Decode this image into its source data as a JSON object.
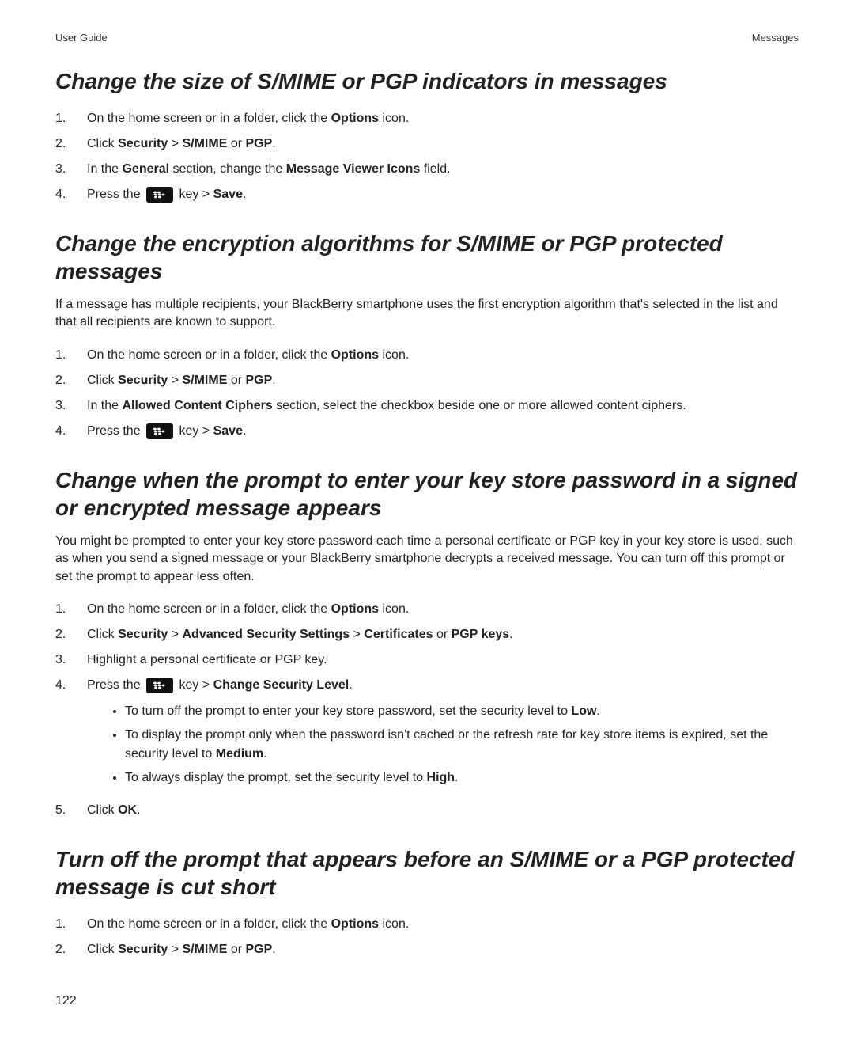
{
  "header": {
    "left": "User Guide",
    "right": "Messages"
  },
  "sec1": {
    "title": "Change the size of S/MIME or PGP indicators in messages",
    "steps": [
      {
        "pre": "On the home screen or in a folder, click the ",
        "b1": "Options",
        "post": " icon."
      },
      {
        "pre": "Click ",
        "b1": "Security",
        "gt1": " > ",
        "b2": "S/MIME",
        "or": " or ",
        "b3": "PGP",
        "post": "."
      },
      {
        "pre": "In the ",
        "b1": "General",
        "mid": " section, change the ",
        "b2": "Message Viewer Icons",
        "post": " field."
      },
      {
        "pre": "Press the ",
        "mid": " key > ",
        "b1": "Save",
        "post": "."
      }
    ]
  },
  "sec2": {
    "title": "Change the encryption algorithms for S/MIME or PGP protected messages",
    "intro": "If a message has multiple recipients, your BlackBerry smartphone uses the first encryption algorithm that's selected in the list and that all recipients are known to support.",
    "steps": [
      {
        "pre": "On the home screen or in a folder, click the ",
        "b1": "Options",
        "post": " icon."
      },
      {
        "pre": "Click ",
        "b1": "Security",
        "gt1": " > ",
        "b2": "S/MIME",
        "or": " or ",
        "b3": "PGP",
        "post": "."
      },
      {
        "pre": "In the ",
        "b1": "Allowed Content Ciphers",
        "post": " section, select the checkbox beside one or more allowed content ciphers."
      },
      {
        "pre": "Press the ",
        "mid": " key > ",
        "b1": "Save",
        "post": "."
      }
    ]
  },
  "sec3": {
    "title": "Change when the prompt to enter your key store password in a signed or encrypted message appears",
    "intro": "You might be prompted to enter your key store password each time a personal certificate or PGP key in your key store is used, such as when you send a signed message or your BlackBerry smartphone decrypts a received message. You can turn off this prompt or set the prompt to appear less often.",
    "steps": [
      {
        "pre": "On the home screen or in a folder, click the ",
        "b1": "Options",
        "post": " icon."
      },
      {
        "pre": "Click ",
        "b1": "Security",
        "gt1": " > ",
        "b2": "Advanced Security Settings",
        "gt2": " > ",
        "b3": "Certificates",
        "or": " or ",
        "b4": "PGP keys",
        "post": "."
      },
      {
        "pre": "Highlight a personal certificate or PGP key."
      },
      {
        "pre": "Press the ",
        "mid": " key > ",
        "b1": "Change Security Level",
        "post": ".",
        "sub": [
          {
            "pre": "To turn off the prompt to enter your key store password, set the security level to ",
            "b1": "Low",
            "post": "."
          },
          {
            "pre": "To display the prompt only when the password isn't cached or the refresh rate for key store items is expired, set the security level to ",
            "b1": "Medium",
            "post": "."
          },
          {
            "pre": "To always display the prompt, set the security level to ",
            "b1": "High",
            "post": "."
          }
        ]
      },
      {
        "pre": "Click ",
        "b1": "OK",
        "post": "."
      }
    ]
  },
  "sec4": {
    "title": "Turn off the prompt that appears before an S/MIME or a PGP protected message is cut short",
    "steps": [
      {
        "pre": "On the home screen or in a folder, click the ",
        "b1": "Options",
        "post": " icon."
      },
      {
        "pre": "Click ",
        "b1": "Security",
        "gt1": " > ",
        "b2": "S/MIME",
        "or": " or ",
        "b3": "PGP",
        "post": "."
      }
    ]
  },
  "page_number": "122"
}
